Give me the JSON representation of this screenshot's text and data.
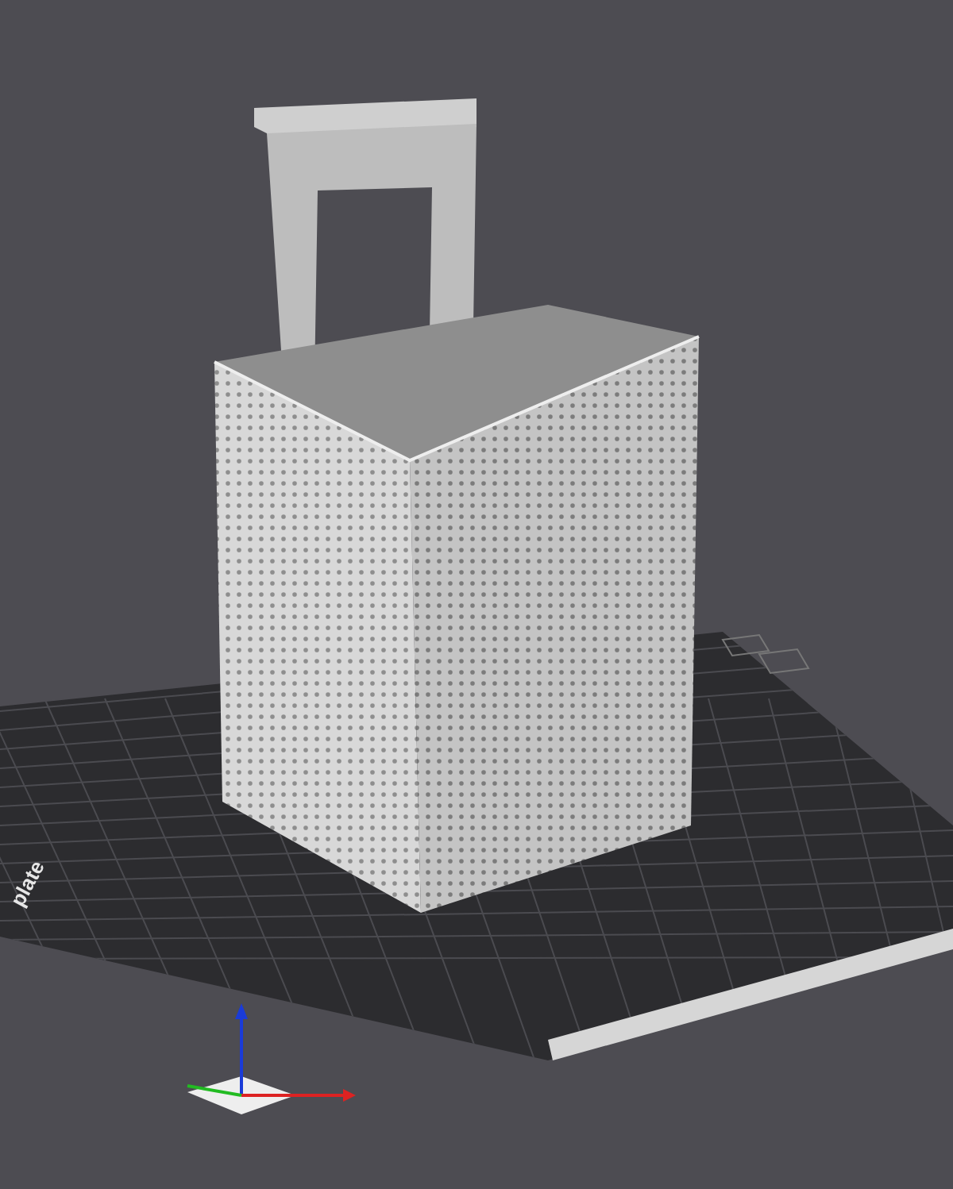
{
  "viewport": {
    "plate_label": "plate"
  }
}
